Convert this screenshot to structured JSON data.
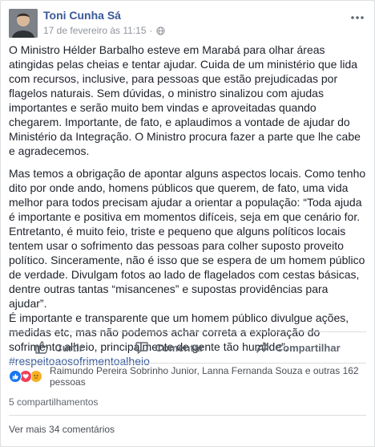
{
  "post": {
    "author": "Toni Cunha Sá",
    "timestamp": "17 de fevereiro às 11:15",
    "dot": "·",
    "privacy_icon": "globe-icon",
    "more_icon": "more-icon",
    "paragraph1": "O Ministro Hélder Barbalho esteve em Marabá para olhar áreas atingidas pelas cheias e tentar ajudar. Cuida de um ministério que lida com recursos, inclusive, para pessoas que estão prejudicadas por flagelos naturais. Sem dúvidas, o ministro sinalizou com ajudas importantes e serão muito bem vindas e aproveitadas quando chegarem. Importante, de fato, e aplaudimos a vontade de ajudar do Ministério da Integração. O Ministro procura fazer a parte que lhe cabe e agradecemos.",
    "paragraph2": "Mas temos a obrigação de apontar alguns aspectos locais. Como tenho dito por onde ando, homens públicos que querem, de fato, uma vida melhor para todos precisam ajudar a orientar a população: “Toda ajuda é importante e positiva em momentos difíceis, seja em que cenário for. Entretanto, é muito feio, triste e pequeno que alguns políticos locais tentem usar o sofrimento das pessoas para colher suposto proveito político. Sinceramente, não é isso que se espera de um homem público de verdade. Divulgam fotos ao lado de flagelados com cestas básicas, dentre outras tantas “misancenes” e supostas providências para ajudar”.",
    "paragraph3": "É importante e transparente que um homem público divulgue ações, medidas etc, mas não podemos achar correta a exploração do sofrimento alheio, principalmente de gente tão humilde”.",
    "hashtag": "#respeitoaosofrimentoalheio"
  },
  "actions": {
    "like_label": "Curtir",
    "comment_label": "Comentar",
    "share_label": "Compartilhar"
  },
  "reactions": {
    "types": [
      "like",
      "love",
      "sad"
    ],
    "summary": "Raimundo Pereira Sobrinho Junior, Lanna Fernanda Souza e outras 162 pessoas"
  },
  "shares_text": "5 compartilhamentos",
  "view_more_comments": "Ver mais 34 comentários",
  "colors": {
    "link_blue": "#385898",
    "hashtag_blue": "#365899",
    "muted_gray": "#90949c",
    "like_blue": "#1877f2",
    "love_red": "#f33e58",
    "sad_yellow": "#f7b125"
  }
}
